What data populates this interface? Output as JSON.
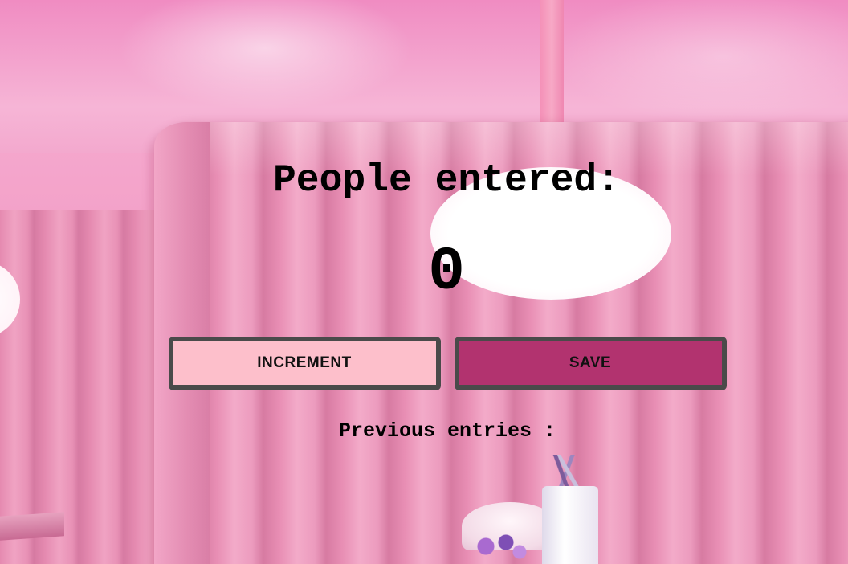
{
  "counter": {
    "title": "People entered:",
    "value": "0"
  },
  "buttons": {
    "increment_label": "INCREMENT",
    "save_label": "SAVE"
  },
  "entries": {
    "heading": "Previous entries :"
  },
  "colors": {
    "increment_button": "#fdbfcb",
    "save_button": "#b2336f",
    "button_border": "#4a4a4a",
    "text": "#000000"
  }
}
